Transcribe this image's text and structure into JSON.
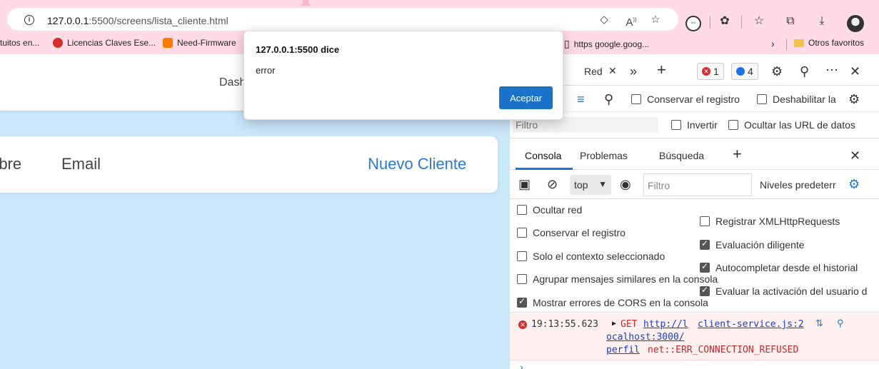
{
  "browser": {
    "url_host": "127.0.0.1",
    "url_rest": ":5500/screens/lista_cliente.html"
  },
  "bookmarks": [
    {
      "label": "tuitos en..."
    },
    {
      "label": "Licencias Claves Ese..."
    },
    {
      "label": "Need-Firmware"
    },
    {
      "label": "https   google.goog..."
    },
    {
      "label": "Otros favoritos"
    }
  ],
  "page": {
    "nav_dashboard": "Dash",
    "table_headers": {
      "nombre": "mbre",
      "email": "Email"
    },
    "new_client_link": "Nuevo Cliente"
  },
  "dialog": {
    "title": "127.0.0.1:5500 dice",
    "message": "error",
    "accept_label": "Aceptar"
  },
  "devtools": {
    "tab_red": "Red",
    "errors_count": "1",
    "messages_count": "4",
    "preserve_log": "Conservar el registro",
    "disable_cache": "Deshabilitar la",
    "filter_placeholder": "Filtro",
    "invert": "Invertir",
    "hide_data_urls": "Ocultar las URL de datos",
    "console_tabs": {
      "consola": "Consola",
      "problemas": "Problemas",
      "busqueda": "Búsqueda"
    },
    "context": "top",
    "console_filter": "Filtro",
    "levels": "Niveles predeterr",
    "settings_left": [
      {
        "label": "Ocultar red",
        "checked": false
      },
      {
        "label": "Conservar el registro",
        "checked": false
      },
      {
        "label": "Solo el contexto seleccionado",
        "checked": false
      },
      {
        "label": "Agrupar mensajes similares en la consola",
        "checked": false
      },
      {
        "label": "Mostrar errores de CORS en la consola",
        "checked": true
      }
    ],
    "settings_right": [
      {
        "label": "Registrar XMLHttpRequests",
        "checked": false
      },
      {
        "label": "Evaluación diligente",
        "checked": true
      },
      {
        "label": "Autocompletar desde el historial",
        "checked": true
      },
      {
        "label": "Evaluar la activación del usuario d",
        "checked": true
      }
    ],
    "error": {
      "time": "19:13:55.623",
      "method": "GET",
      "url_part1": "http://l",
      "url_part2": "ocalhost:3000/",
      "url_part3": "perfil",
      "source": "client-service.js:2",
      "message": "net::ERR_CONNECTION_REFUSED"
    }
  }
}
